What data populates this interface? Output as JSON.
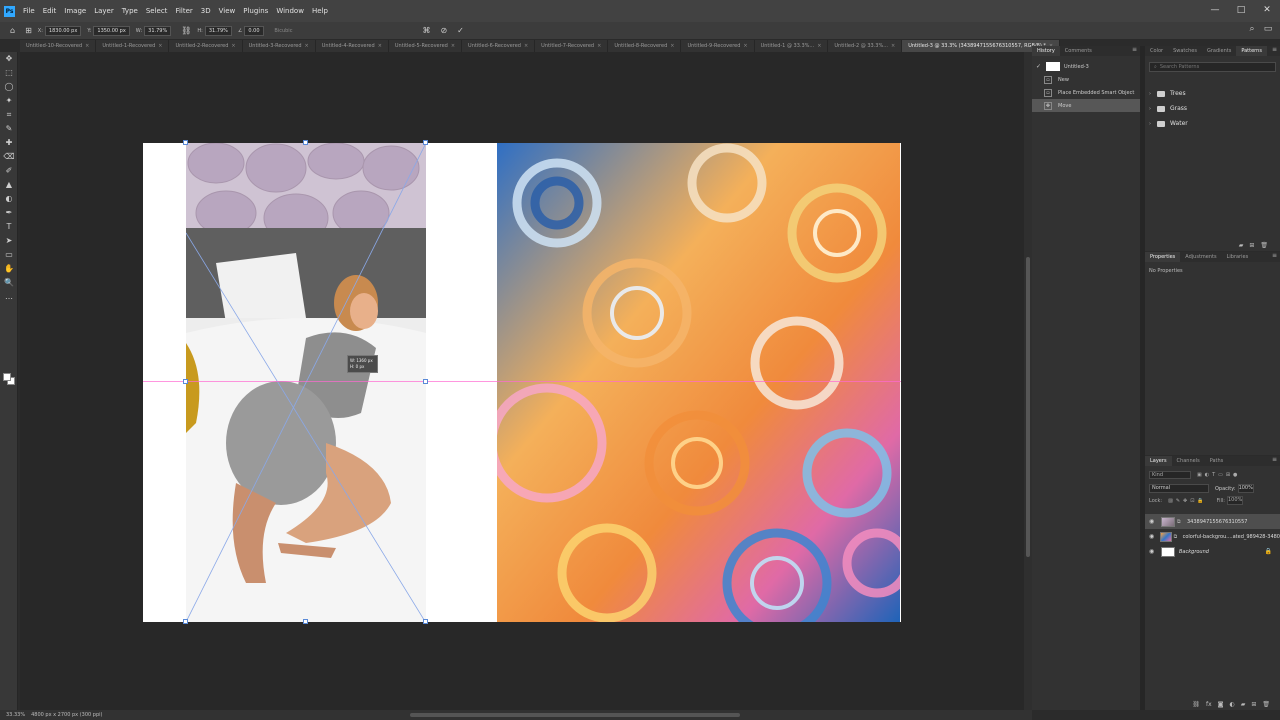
{
  "app": {
    "logo": "Ps",
    "menu": [
      "File",
      "Edit",
      "Image",
      "Layer",
      "Type",
      "Select",
      "Filter",
      "3D",
      "View",
      "Plugins",
      "Window",
      "Help"
    ],
    "window_controls": [
      "—",
      "□",
      "✕"
    ]
  },
  "options": {
    "x_label": "X:",
    "x_value": "1830.00 px",
    "y_label": "Y:",
    "y_value": "1350.00 px",
    "w_label": "W:",
    "w_value": "31.79%",
    "h_label": "H:",
    "h_value": "31.79%",
    "angle_value": "0.00",
    "interp_label": "Bicubic"
  },
  "tabs": [
    {
      "label": "Untitled-10-Recovered",
      "active": false
    },
    {
      "label": "Untitled-1-Recovered",
      "active": false
    },
    {
      "label": "Untitled-2-Recovered",
      "active": false
    },
    {
      "label": "Untitled-3-Recovered",
      "active": false
    },
    {
      "label": "Untitled-4-Recovered",
      "active": false
    },
    {
      "label": "Untitled-5-Recovered",
      "active": false
    },
    {
      "label": "Untitled-6-Recovered",
      "active": false
    },
    {
      "label": "Untitled-7-Recovered",
      "active": false
    },
    {
      "label": "Untitled-8-Recovered",
      "active": false
    },
    {
      "label": "Untitled-9-Recovered",
      "active": false
    },
    {
      "label": "Untitled-1 @ 33.3%...",
      "active": false
    },
    {
      "label": "Untitled-2 @ 33.3%...",
      "active": false
    },
    {
      "label": "Untitled-3 @ 33.3% (3438947155676310557, RGB/8) *",
      "active": true
    }
  ],
  "tools": [
    "✥",
    "⬚",
    "◯",
    "✦",
    "⌗",
    "✎",
    "✚",
    "⌫",
    "✐",
    "▲",
    "◐",
    "✒",
    "T",
    "➤",
    "▭",
    "✋",
    "🔍",
    "…"
  ],
  "transform_tooltip": {
    "w": "W: 1360 px",
    "h": "H:   0 px"
  },
  "status": {
    "zoom": "33.33%",
    "doc_info": "4800 px x 2700 px (300 ppi)"
  },
  "history": {
    "tabs": [
      "History",
      "Comments"
    ],
    "snapshot": "Untitled-3",
    "items": [
      "New",
      "Place Embedded Smart Object",
      "Move"
    ]
  },
  "patterns": {
    "tabs": [
      "Color",
      "Swatches",
      "Gradients",
      "Patterns"
    ],
    "search_placeholder": "Search Patterns",
    "folders": [
      "Trees",
      "Grass",
      "Water"
    ]
  },
  "properties": {
    "tabs": [
      "Properties",
      "Adjustments",
      "Libraries"
    ],
    "empty_text": "No Properties"
  },
  "layers": {
    "tabs": [
      "Layers",
      "Channels",
      "Paths"
    ],
    "kind_label": "Kind",
    "blend_mode": "Normal",
    "opacity_label": "Opacity:",
    "opacity_value": "100%",
    "lock_label": "Lock:",
    "fill_label": "Fill:",
    "fill_value": "100%",
    "items": [
      {
        "name": "3438947155676310557",
        "active": true,
        "thumb": "so",
        "linked": true
      },
      {
        "name": "colorful-backgrou....ated_989428-3480",
        "active": false,
        "thumb": "cl",
        "linked": true
      },
      {
        "name": "Background",
        "active": false,
        "thumb": "bg",
        "linked": false,
        "locked": true
      }
    ]
  },
  "colors": {
    "accent": "#31a8ff",
    "guide": "#ff69d2",
    "handle_border": "#5a8ad8"
  }
}
